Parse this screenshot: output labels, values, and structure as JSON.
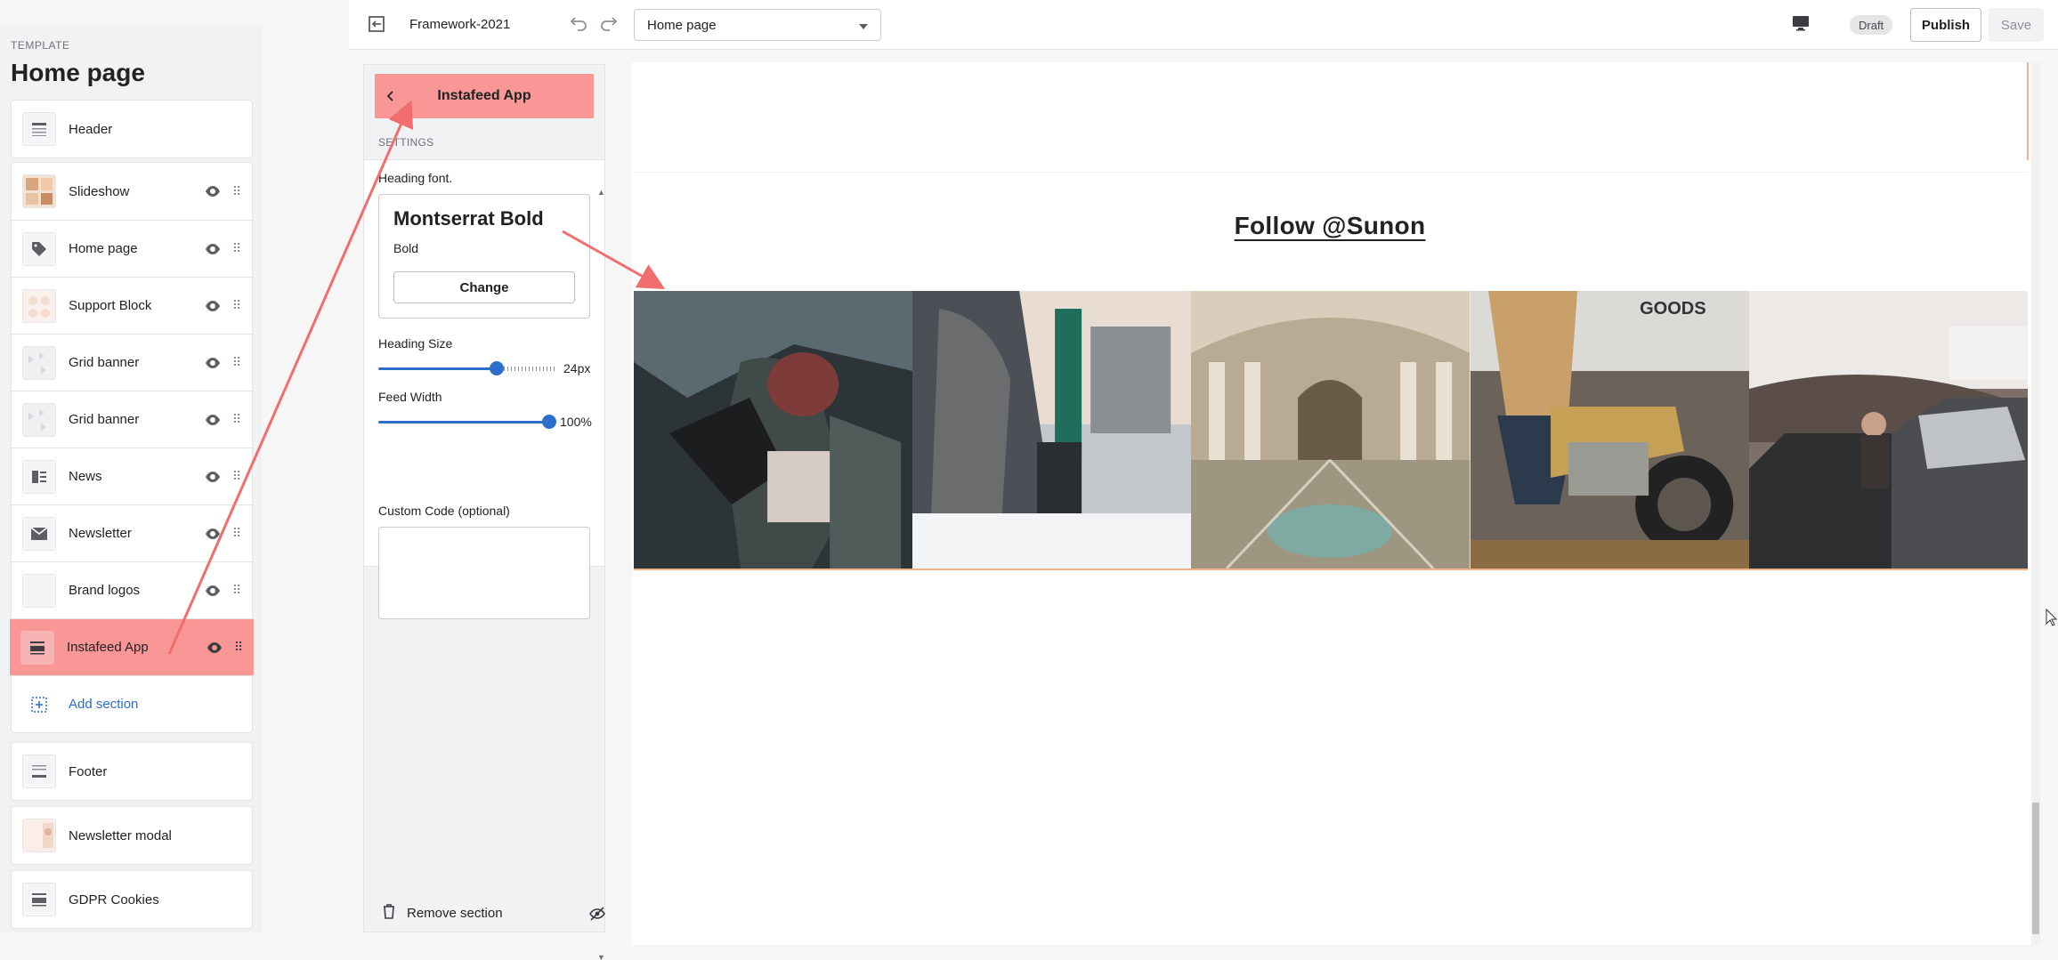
{
  "left_panel": {
    "template_label": "TEMPLATE",
    "title": "Home page",
    "header": {
      "label": "Header"
    },
    "sections": [
      {
        "label": "Slideshow",
        "icon": "image-thumb"
      },
      {
        "label": "Home page",
        "icon": "tag-icon"
      },
      {
        "label": "Support Block",
        "icon": "image-thumb"
      },
      {
        "label": "Grid banner",
        "icon": "image-thumb"
      },
      {
        "label": "Grid banner",
        "icon": "image-thumb"
      },
      {
        "label": "News",
        "icon": "blog-icon"
      },
      {
        "label": "Newsletter",
        "icon": "envelope-icon"
      },
      {
        "label": "Brand logos",
        "icon": "blank-thumb"
      },
      {
        "label": "Instafeed App",
        "icon": "section-icon",
        "active": true
      }
    ],
    "add_section": "Add section",
    "footer": {
      "label": "Footer"
    },
    "newsletter_modal": {
      "label": "Newsletter modal"
    },
    "gdpr": {
      "label": "GDPR Cookies"
    }
  },
  "topbar": {
    "title": "Framework-2021",
    "page_select": "Home page",
    "draft_badge": "Draft",
    "publish": "Publish",
    "save": "Save"
  },
  "settings": {
    "title": "Instafeed App",
    "section_label": "SETTINGS",
    "heading_font_label": "Heading font.",
    "font_name": "Montserrat Bold",
    "font_style": "Bold",
    "change": "Change",
    "heading_size_label": "Heading Size",
    "heading_size_value": "24px",
    "heading_size_fraction": 0.68,
    "feed_width_label": "Feed Width",
    "feed_width_value": "100%",
    "feed_width_fraction": 1.0,
    "custom_code_label": "Custom Code (optional)",
    "remove_section": "Remove section"
  },
  "preview": {
    "heading": "Follow @Sunon"
  },
  "colors": {
    "highlight": "#f99797",
    "accent": "#2c6ecb",
    "annotation": "#f26d6d"
  }
}
